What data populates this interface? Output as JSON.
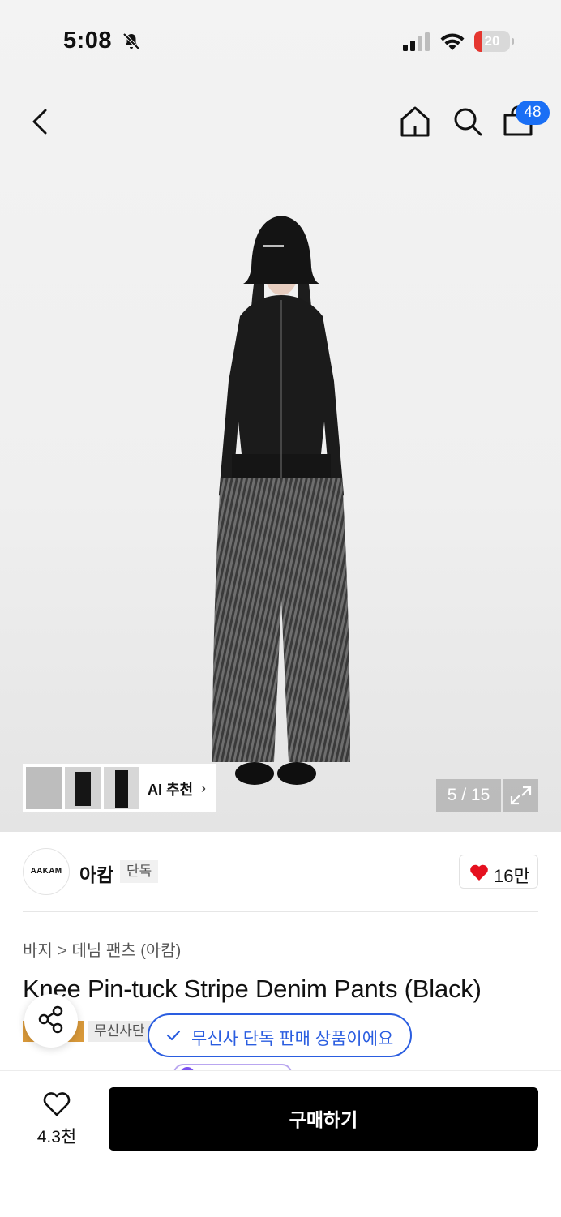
{
  "status_bar": {
    "time": "5:08",
    "battery": "20",
    "battery_level": 0.2
  },
  "nav": {
    "cart_count": "48"
  },
  "gallery": {
    "ai_label": "AI 추천",
    "counter": "5 / 15",
    "current": 5,
    "total": 15
  },
  "brand": {
    "logo_text": "AAKAM",
    "name": "아캄",
    "tag": "단독",
    "likes": "16만"
  },
  "breadcrumb": {
    "category": "바지",
    "subcategory": "데님 팬츠 (아캄)"
  },
  "product": {
    "title": "Knee Pin-tuck Stripe Denim Pants (Black)",
    "badge": "무신사단"
  },
  "toast": {
    "message": "무신사 단독 판매 상품이에요"
  },
  "bottom": {
    "wish_count": "4.3천",
    "buy_label": "구매하기"
  },
  "colors": {
    "accent_blue": "#1a6ff5",
    "toast_blue": "#2a5de0",
    "heart_red": "#e5101f",
    "battery_red": "#e5362f"
  }
}
